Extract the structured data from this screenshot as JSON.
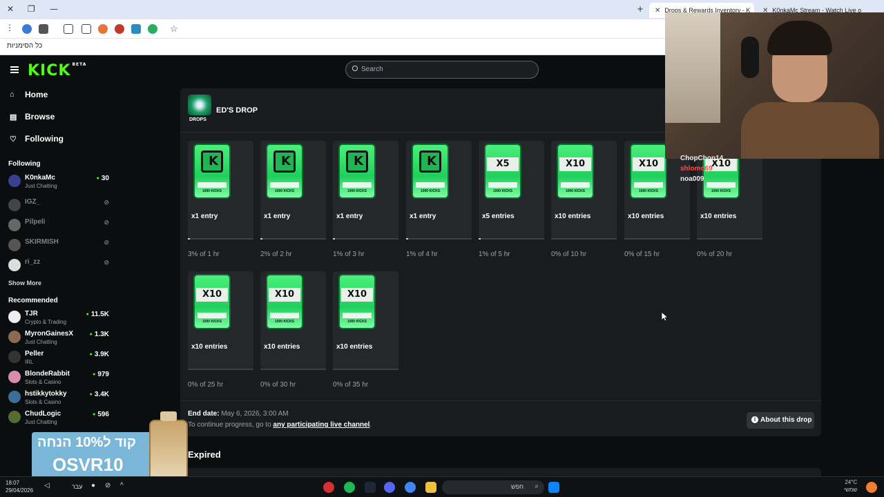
{
  "browser": {
    "tabs": [
      {
        "title": "Drops & Rewards Inventory - K",
        "active": true
      },
      {
        "title": "K0nkaMc Stream - Watch Live o",
        "active": false
      }
    ],
    "bookmarks_label": "כל הסימניות"
  },
  "kick": {
    "logo": "KICK",
    "logo_badge": "BETA",
    "nav": [
      {
        "label": "Home",
        "icon": "home-icon"
      },
      {
        "label": "Browse",
        "icon": "browse-icon"
      },
      {
        "label": "Following",
        "icon": "heart-icon"
      }
    ],
    "following_header": "Following",
    "following": [
      {
        "name": "K0nkaMc",
        "category": "Just Chatting",
        "viewers": "30",
        "live": true
      },
      {
        "name": "IGZ_",
        "category": "",
        "viewers": "",
        "live": false
      },
      {
        "name": "Pilpeli",
        "category": "",
        "viewers": "",
        "live": false
      },
      {
        "name": "SKIRMISH",
        "category": "",
        "viewers": "",
        "live": false
      },
      {
        "name": "ri_zz",
        "category": "",
        "viewers": "",
        "live": false
      }
    ],
    "show_more": "Show More",
    "recommended_header": "Recommended",
    "recommended": [
      {
        "name": "TJR",
        "category": "Crypto & Trading",
        "viewers": "11.5K"
      },
      {
        "name": "MyronGainesX",
        "category": "Just Chatting",
        "viewers": "1.3K"
      },
      {
        "name": "Peller",
        "category": "IRL",
        "viewers": "3.9K"
      },
      {
        "name": "BlondeRabbit",
        "category": "Slots & Casino",
        "viewers": "979"
      },
      {
        "name": "hstikkytokky",
        "category": "Slots & Casino",
        "viewers": "3.4K"
      },
      {
        "name": "ChudLogic",
        "category": "Just Chatting",
        "viewers": "596"
      }
    ],
    "search_placeholder": "Search"
  },
  "drop": {
    "badge": "DROPS",
    "title": "ED'S DROP",
    "rewards": [
      {
        "art": "K",
        "label": "x1 entry",
        "progress_text": "3% of 1 hr",
        "progress": 0.03
      },
      {
        "art": "K",
        "label": "x1 entry",
        "progress_text": "2% of 2 hr",
        "progress": 0.02
      },
      {
        "art": "K",
        "label": "x1 entry",
        "progress_text": "1% of 3 hr",
        "progress": 0.01
      },
      {
        "art": "K",
        "label": "x1 entry",
        "progress_text": "1% of 4 hr",
        "progress": 0.01
      },
      {
        "art": "X5",
        "label": "x5 entries",
        "progress_text": "1% of 5 hr",
        "progress": 0.01
      },
      {
        "art": "X10",
        "label": "x10 entries",
        "progress_text": "0% of 10 hr",
        "progress": 0
      },
      {
        "art": "X10",
        "label": "x10 entries",
        "progress_text": "0% of 15 hr",
        "progress": 0
      },
      {
        "art": "X10",
        "label": "x10 entries",
        "progress_text": "0% of 20 hr",
        "progress": 0
      },
      {
        "art": "X10",
        "label": "x10 entries",
        "progress_text": "0% of 25 hr",
        "progress": 0
      },
      {
        "art": "X10",
        "label": "x10 entries",
        "progress_text": "0% of 30 hr",
        "progress": 0
      },
      {
        "art": "X10",
        "label": "x10 entries",
        "progress_text": "0% of 35 hr",
        "progress": 0
      }
    ],
    "ticket_text": "1000 KICKS",
    "end_date_label": "End date:",
    "end_date_value": "May 6, 2026, 3:00 AM",
    "continue_text": "To continue progress, go to",
    "continue_link": "any participating live channel",
    "about_button": "About this drop",
    "expired_header": "Expired"
  },
  "overlay": {
    "chat": [
      {
        "name": "ChopChop14",
        "color": "#ffffff"
      },
      {
        "name": "shlomo69",
        "color": "#ff4d4d"
      },
      {
        "name": "noa009",
        "color": "#ffffff"
      }
    ],
    "promo_line1": "קוד ל10% הנחה",
    "promo_line2": "OSVR10"
  },
  "taskbar": {
    "time": "18:07",
    "date": "29/04/2026",
    "lang": "עבר",
    "search": "חפש",
    "weather_temp": "24°C",
    "weather_desc": "שמשי"
  }
}
